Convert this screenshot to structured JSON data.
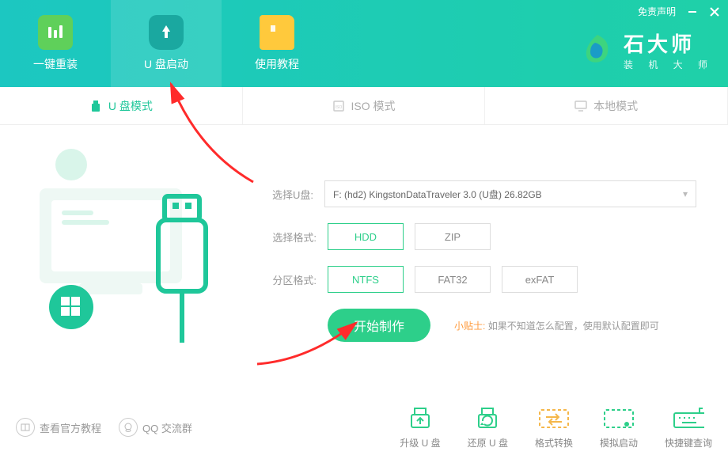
{
  "titlebar": {
    "disclaimer": "免责声明"
  },
  "nav": {
    "items": [
      {
        "label": "一键重装"
      },
      {
        "label": "U 盘启动"
      },
      {
        "label": "使用教程"
      }
    ]
  },
  "brand": {
    "title": "石大师",
    "subtitle": "装 机 大 师"
  },
  "tabs": {
    "items": [
      {
        "label": "U 盘模式"
      },
      {
        "label": "ISO 模式"
      },
      {
        "label": "本地模式"
      }
    ]
  },
  "form": {
    "usb_label": "选择U盘:",
    "usb_value": "F: (hd2) KingstonDataTraveler 3.0 (U盘) 26.82GB",
    "format_label": "选择格式:",
    "format_options": [
      "HDD",
      "ZIP"
    ],
    "format_selected": "HDD",
    "fs_label": "分区格式:",
    "fs_options": [
      "NTFS",
      "FAT32",
      "exFAT"
    ],
    "fs_selected": "NTFS"
  },
  "action": {
    "start": "开始制作",
    "tip_label": "小贴士:",
    "tip_text": "如果不知道怎么配置，使用默认配置即可"
  },
  "footer": {
    "left": [
      {
        "label": "查看官方教程"
      },
      {
        "label": "QQ 交流群"
      }
    ],
    "tools": [
      {
        "label": "升级 U 盘"
      },
      {
        "label": "还原 U 盘"
      },
      {
        "label": "格式转换"
      },
      {
        "label": "模拟启动"
      },
      {
        "label": "快捷键查询"
      }
    ]
  }
}
